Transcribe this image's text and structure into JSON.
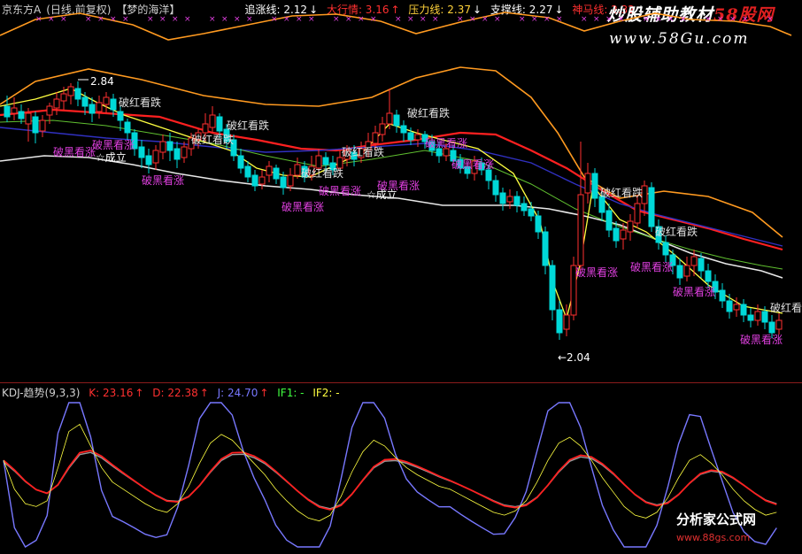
{
  "header": {
    "stock": "京东方A",
    "period": "(日线,前复权)",
    "indicator": "【梦的海洋】",
    "items": [
      {
        "label": "追涨线: 2.12",
        "color": "#ffffff"
      },
      {
        "label": "大行情: 3.16",
        "color": "#ff3030"
      },
      {
        "label": "压力线: 2.37",
        "color": "#ffd23a"
      },
      {
        "label": "支撑线: 2.27",
        "color": "#ffffff"
      },
      {
        "label": "神马线: 2.32",
        "color": "#ff3030"
      }
    ]
  },
  "kdj_header": {
    "title": "KDJ-趋势(9,3,3)",
    "k": "K: 23.16",
    "d": "D: 22.38",
    "j": "J: 24.70",
    "if1": "IF1: -",
    "if2": "IF2: -"
  },
  "watermarks": {
    "top_line1_pre": "炒股辅助教材",
    "top_line1_red": "58股网",
    "top_line2": "www.58Gu.com",
    "bottom_line1": "分析家公式网",
    "bottom_line2": "www.88gs.com"
  },
  "colors": {
    "up": "#ff3030",
    "down": "#00d8d8",
    "ma_red": "#ff2020",
    "ma_orange": "#ff9a20",
    "ma_white": "#e8e8e8",
    "ma_blue": "#3030c0",
    "ma_green": "#60c030",
    "yellow": "#ffff40",
    "kdj_k": "#e0e0e0",
    "kdj_d": "#ff2020",
    "kdj_j": "#7878ff"
  },
  "chart_data": {
    "type": "candlestick",
    "price_annotations": [
      {
        "text": "2.84",
        "value": 2.84
      },
      {
        "text": "←2.04",
        "value": 2.04
      }
    ],
    "signal_labels": [
      {
        "text": "破红看跌",
        "color": "#e0e0e0"
      },
      {
        "text": "破红看跌",
        "color": "#e0e0e0"
      },
      {
        "text": "破红看跌",
        "color": "#e0e0e0"
      },
      {
        "text": "破红看跌",
        "color": "#e0e0e0"
      },
      {
        "text": "破红看跌",
        "color": "#e0e0e0"
      },
      {
        "text": "破红看跌",
        "color": "#e0e0e0"
      },
      {
        "text": "破红看跌",
        "color": "#e0e0e0"
      },
      {
        "text": "破红看跌",
        "color": "#e0e0e0"
      },
      {
        "text": "破黑看涨",
        "color": "#e040e0"
      },
      {
        "text": "破黑看涨",
        "color": "#e040e0"
      },
      {
        "text": "破黑看涨",
        "color": "#e040e0"
      },
      {
        "text": "破黑看涨",
        "color": "#e040e0"
      },
      {
        "text": "破黑看涨",
        "color": "#e040e0"
      },
      {
        "text": "破黑看涨",
        "color": "#e040e0"
      },
      {
        "text": "破黑看涨",
        "color": "#e040e0"
      },
      {
        "text": "破黑看涨",
        "color": "#e040e0"
      },
      {
        "text": "破黑看涨",
        "color": "#e040e0"
      },
      {
        "text": "破黑看涨",
        "color": "#e040e0"
      },
      {
        "text": "破黑看涨",
        "color": "#e040e0"
      },
      {
        "text": "☆成立",
        "color": "#ffffff"
      },
      {
        "text": "☆成立",
        "color": "#ffffff"
      }
    ],
    "kdj_last": {
      "K": 23.16,
      "D": 22.38,
      "J": 24.7
    }
  }
}
